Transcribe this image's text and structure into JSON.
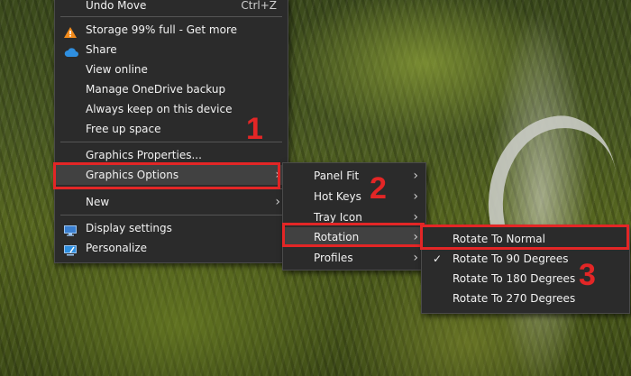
{
  "main_menu": {
    "items": [
      {
        "label": "Undo Move",
        "shortcut": "Ctrl+Z"
      },
      {
        "label": "Storage 99% full - Get more",
        "icon": "warning-icon"
      },
      {
        "label": "Share",
        "icon": "cloud-icon"
      },
      {
        "label": "View online"
      },
      {
        "label": "Manage OneDrive backup"
      },
      {
        "label": "Always keep on this device"
      },
      {
        "label": "Free up space"
      },
      {
        "label": "Graphics Properties..."
      },
      {
        "label": "Graphics Options"
      },
      {
        "label": "New"
      },
      {
        "label": "Display settings",
        "icon": "display-icon"
      },
      {
        "label": "Personalize",
        "icon": "personalize-icon"
      }
    ]
  },
  "graphics_submenu": {
    "items": [
      {
        "label": "Panel Fit"
      },
      {
        "label": "Hot Keys"
      },
      {
        "label": "Tray Icon"
      },
      {
        "label": "Rotation"
      },
      {
        "label": "Profiles"
      }
    ]
  },
  "rotation_submenu": {
    "items": [
      {
        "label": "Rotate To Normal",
        "checked": false
      },
      {
        "label": "Rotate To 90 Degrees",
        "checked": true
      },
      {
        "label": "Rotate To 180 Degrees",
        "checked": false
      },
      {
        "label": "Rotate To 270 Degrees",
        "checked": false
      }
    ]
  },
  "annotations": {
    "step1": "1",
    "step2": "2",
    "step3": "3"
  },
  "colors": {
    "highlight": "#e32626",
    "menu_bg": "#2b2b2b",
    "warning": "#f28b1c",
    "onedrive": "#2f8fe0"
  }
}
